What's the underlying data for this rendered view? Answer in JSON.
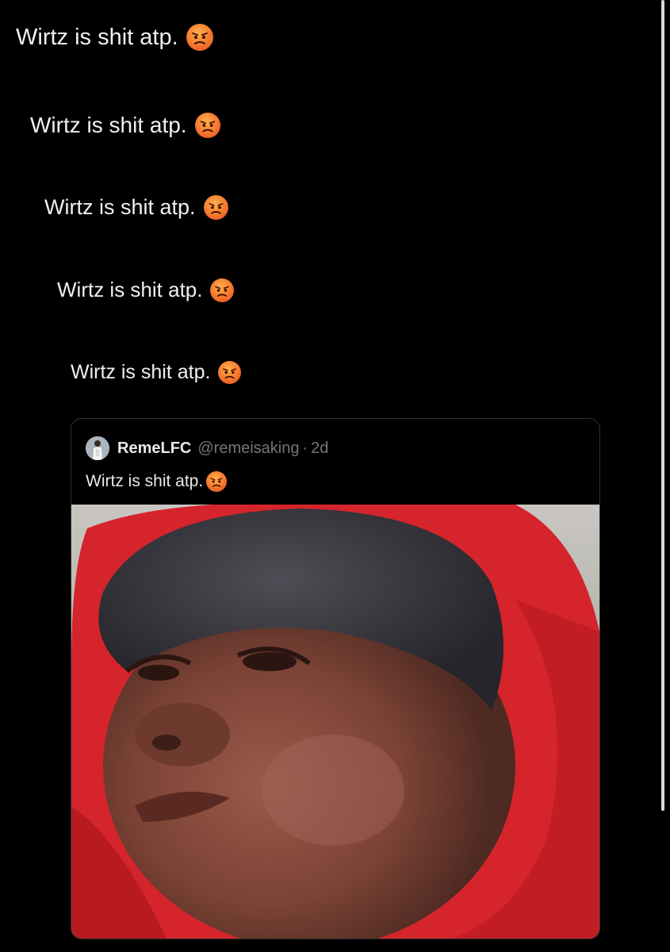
{
  "thread": {
    "lines": [
      {
        "text": "Wirtz is shit atp.",
        "emoji": "angry-face-icon"
      },
      {
        "text": "Wirtz is shit atp.",
        "emoji": "angry-face-icon"
      },
      {
        "text": "Wirtz is shit atp.",
        "emoji": "angry-face-icon"
      },
      {
        "text": "Wirtz is shit atp.",
        "emoji": "angry-face-icon"
      },
      {
        "text": "Wirtz is shit atp.",
        "emoji": "angry-face-icon"
      }
    ]
  },
  "quoted_tweet": {
    "display_name": "RemeLFC",
    "handle": "@remeisaking",
    "separator": "·",
    "time": "2d",
    "text": "Wirtz is shit atp.",
    "emoji": "angry-face-icon",
    "media": "photo of a child in a red hoodie and grey beanie with a skeptical look"
  },
  "colors": {
    "background": "#000000",
    "text": "#e7e9ea",
    "muted": "#71767b",
    "border": "#2f3336",
    "emoji": "#f4762e"
  }
}
